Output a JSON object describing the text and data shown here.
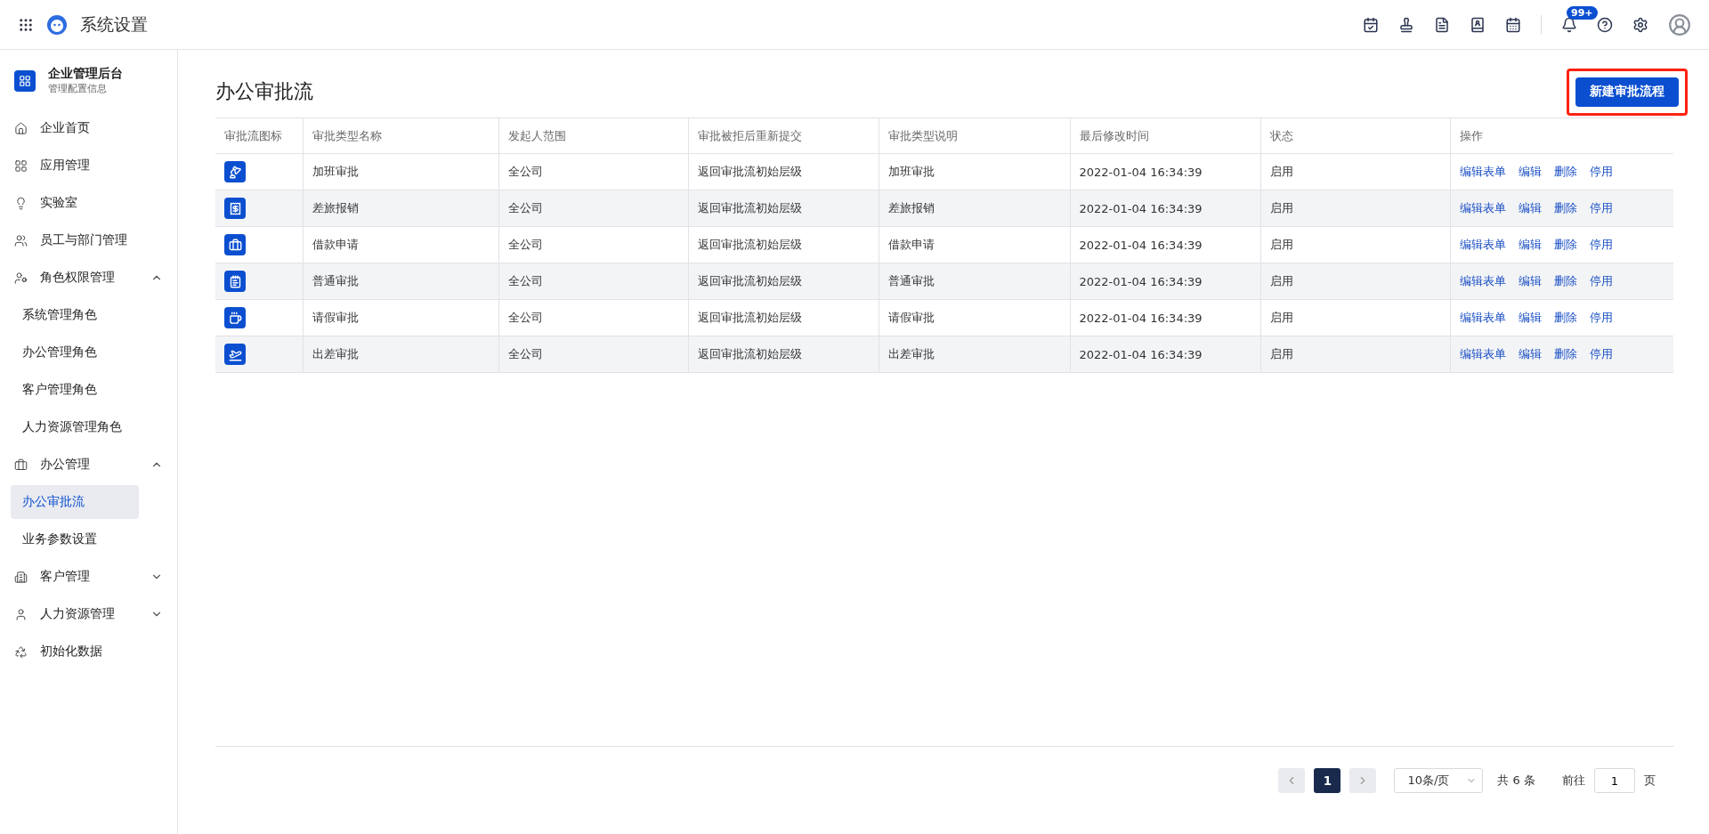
{
  "header": {
    "title": "系统设置",
    "notification_badge": "99+"
  },
  "sidebar": {
    "org": {
      "name": "企业管理后台",
      "subtitle": "管理配置信息"
    },
    "items": [
      {
        "kind": "item",
        "label": "企业首页",
        "selected": false
      },
      {
        "kind": "item",
        "label": "应用管理",
        "selected": false
      },
      {
        "kind": "item",
        "label": "实验室",
        "selected": false
      },
      {
        "kind": "item",
        "label": "员工与部门管理",
        "selected": false
      },
      {
        "kind": "group",
        "label": "角色权限管理",
        "expanded": true,
        "children": [
          {
            "label": "系统管理角色",
            "selected": false
          },
          {
            "label": "办公管理角色",
            "selected": false
          },
          {
            "label": "客户管理角色",
            "selected": false
          },
          {
            "label": "人力资源管理角色",
            "selected": false
          }
        ]
      },
      {
        "kind": "group",
        "label": "办公管理",
        "expanded": true,
        "children": [
          {
            "label": "办公审批流",
            "selected": true
          },
          {
            "label": "业务参数设置",
            "selected": false
          }
        ]
      },
      {
        "kind": "group",
        "label": "客户管理",
        "expanded": false
      },
      {
        "kind": "group",
        "label": "人力资源管理",
        "expanded": false
      },
      {
        "kind": "item",
        "label": "初始化数据",
        "selected": false
      }
    ]
  },
  "page": {
    "title": "办公审批流",
    "new_button": {
      "label": "新建审批流程",
      "highlighted": true
    }
  },
  "table": {
    "columns": [
      "审批流图标",
      "审批类型名称",
      "发起人范围",
      "审批被拒后重新提交",
      "审批类型说明",
      "最后修改时间",
      "状态",
      "操作"
    ],
    "rows": [
      {
        "name": "加班审批",
        "scope": "全公司",
        "resubmit": "返回审批流初始层级",
        "description": "加班审批",
        "modified": "2022-01-04 16:34:39",
        "status": "启用",
        "actions": [
          "编辑表单",
          "编辑",
          "删除",
          "停用"
        ]
      },
      {
        "name": "差旅报销",
        "scope": "全公司",
        "resubmit": "返回审批流初始层级",
        "description": "差旅报销",
        "modified": "2022-01-04 16:34:39",
        "status": "启用",
        "actions": [
          "编辑表单",
          "编辑",
          "删除",
          "停用"
        ]
      },
      {
        "name": "借款申请",
        "scope": "全公司",
        "resubmit": "返回审批流初始层级",
        "description": "借款申请",
        "modified": "2022-01-04 16:34:39",
        "status": "启用",
        "actions": [
          "编辑表单",
          "编辑",
          "删除",
          "停用"
        ]
      },
      {
        "name": "普通审批",
        "scope": "全公司",
        "resubmit": "返回审批流初始层级",
        "description": "普通审批",
        "modified": "2022-01-04 16:34:39",
        "status": "启用",
        "actions": [
          "编辑表单",
          "编辑",
          "删除",
          "停用"
        ]
      },
      {
        "name": "请假审批",
        "scope": "全公司",
        "resubmit": "返回审批流初始层级",
        "description": "请假审批",
        "modified": "2022-01-04 16:34:39",
        "status": "启用",
        "actions": [
          "编辑表单",
          "编辑",
          "删除",
          "停用"
        ]
      },
      {
        "name": "出差审批",
        "scope": "全公司",
        "resubmit": "返回审批流初始层级",
        "description": "出差审批",
        "modified": "2022-01-04 16:34:39",
        "status": "启用",
        "actions": [
          "编辑表单",
          "编辑",
          "删除",
          "停用"
        ]
      }
    ]
  },
  "pagination": {
    "pages": [
      {
        "label": "1",
        "selected": true
      }
    ],
    "page_size": "10条/页",
    "total": "共 6 条",
    "goto_label": "前往",
    "goto_value": "1",
    "goto_suffix": "页"
  }
}
